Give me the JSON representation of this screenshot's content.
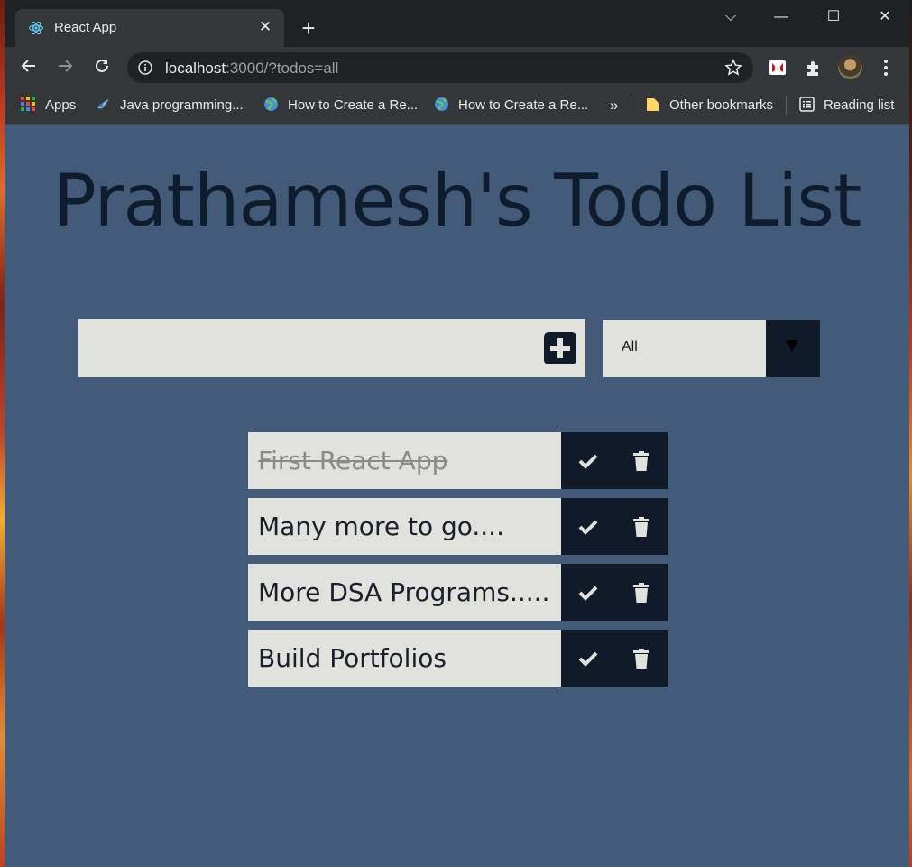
{
  "browser": {
    "tab_title": "React App",
    "tab_close": "✕",
    "new_tab": "+",
    "url_host": "localhost",
    "url_rest": ":3000/?todos=all",
    "window_controls": {
      "collapse": "⌵",
      "minimize": "—",
      "maximize": "☐",
      "close": "✕"
    }
  },
  "bookmarks": [
    {
      "label": "Apps",
      "icon": "apps-grid-icon"
    },
    {
      "label": "Java programming...",
      "icon": "java-site-icon"
    },
    {
      "label": "How to Create a Re...",
      "icon": "globe-icon"
    },
    {
      "label": "How to Create a Re...",
      "icon": "globe-icon"
    }
  ],
  "bookmarks_overflow": "»",
  "other_bookmarks": "Other bookmarks",
  "reading_list": "Reading list",
  "page": {
    "heading": "Prathamesh's Todo List",
    "input_value": "",
    "filter_value": "All"
  },
  "todos": [
    {
      "text": "First React App",
      "completed": true
    },
    {
      "text": "Many more to go....",
      "completed": false
    },
    {
      "text": "More DSA Programs.....",
      "completed": false
    },
    {
      "text": "Build Portfolios",
      "completed": false
    }
  ],
  "colors": {
    "page_bg": "#435b79",
    "heading": "#0f1c2e",
    "item_bg": "#e1e1dd",
    "button_bg": "#111a28"
  }
}
